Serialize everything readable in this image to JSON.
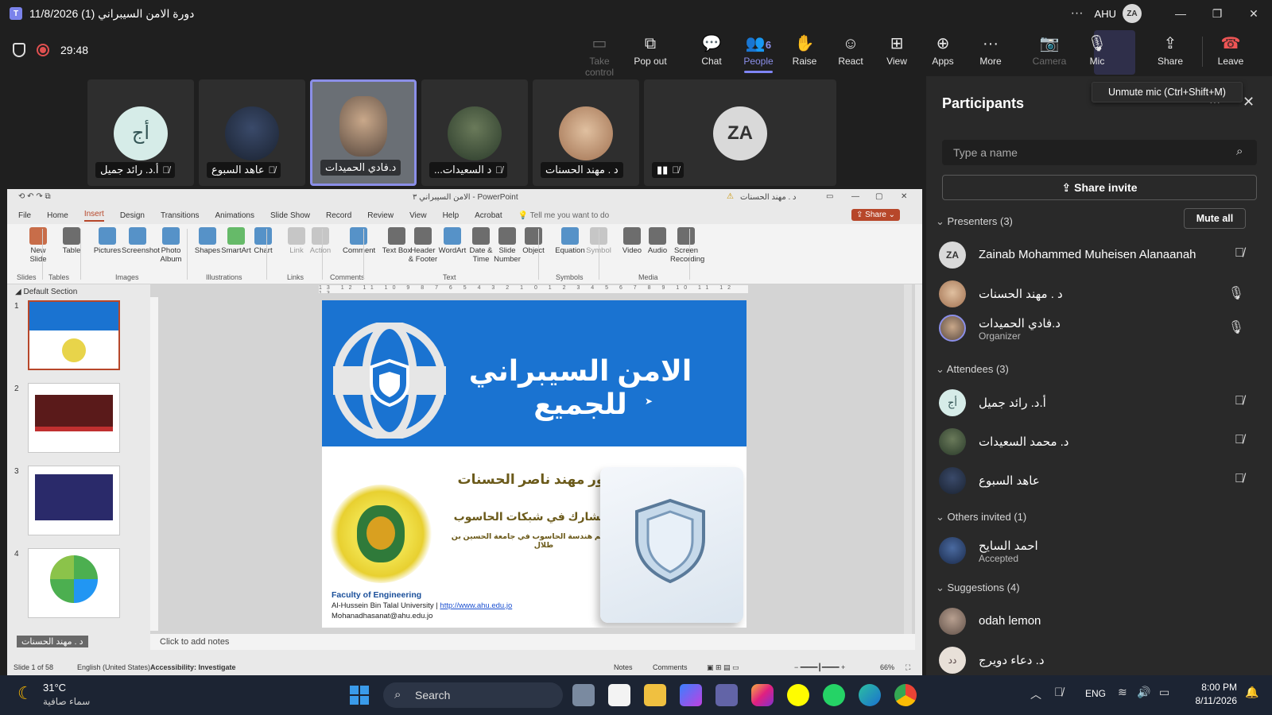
{
  "window": {
    "title": "دورة الامن السيبراني (1) 11/8/2026",
    "org": "AHU",
    "user_initials": "ZA"
  },
  "meeting": {
    "timer": "29:48",
    "buttons": [
      {
        "label": "Take control",
        "icon": "take-control-icon"
      },
      {
        "label": "Pop out",
        "icon": "pop-out-icon"
      },
      {
        "label": "Chat",
        "icon": "chat-icon"
      },
      {
        "label": "People",
        "icon": "people-icon",
        "count": "6"
      },
      {
        "label": "Raise",
        "icon": "raise-hand-icon"
      },
      {
        "label": "React",
        "icon": "react-icon"
      },
      {
        "label": "View",
        "icon": "view-icon"
      },
      {
        "label": "Apps",
        "icon": "apps-icon"
      },
      {
        "label": "More",
        "icon": "more-icon"
      },
      {
        "label": "Camera",
        "icon": "camera-off-icon"
      },
      {
        "label": "Mic",
        "icon": "mic-off-icon"
      },
      {
        "label": "Share",
        "icon": "share-icon"
      },
      {
        "label": "Leave",
        "icon": "leave-icon"
      }
    ],
    "tooltip": "Unmute mic (Ctrl+Shift+M)"
  },
  "tiles": [
    {
      "name": "أ.د. رائد جميل",
      "initials": "أج"
    },
    {
      "name": "عاهد السبوع"
    },
    {
      "name": "د.فادي الحميدات"
    },
    {
      "name": "د. محمد السعيدات",
      "display": "...د السعيدات"
    },
    {
      "name": "د . مهند الحسنات"
    },
    {
      "name": "",
      "initials": "ZA"
    }
  ],
  "ppt": {
    "title": "الامن السيبراني ٣ - PowerPoint",
    "user": "د . مهند الحسنات",
    "menu": [
      "File",
      "Home",
      "Insert",
      "Design",
      "Transitions",
      "Animations",
      "Slide Show",
      "Record",
      "Review",
      "View",
      "Help",
      "Acrobat"
    ],
    "tell_me": "Tell me you want to do",
    "share": "Share",
    "ribbon": [
      {
        "label": "New Slide"
      },
      {
        "label": "Table"
      },
      {
        "label": "Pictures"
      },
      {
        "label": "Screenshot"
      },
      {
        "label": "Photo Album"
      },
      {
        "label": "Shapes"
      },
      {
        "label": "SmartArt"
      },
      {
        "label": "Chart"
      },
      {
        "label": "Link"
      },
      {
        "label": "Action"
      },
      {
        "label": "Comment"
      },
      {
        "label": "Text Box"
      },
      {
        "label": "Header & Footer"
      },
      {
        "label": "WordArt"
      },
      {
        "label": "Date & Time"
      },
      {
        "label": "Slide Number"
      },
      {
        "label": "Object"
      },
      {
        "label": "Equation"
      },
      {
        "label": "Symbol"
      },
      {
        "label": "Video"
      },
      {
        "label": "Audio"
      },
      {
        "label": "Screen Recording"
      }
    ],
    "groups": [
      "Slides",
      "Tables",
      "Images",
      "Illustrations",
      "Links",
      "Comments",
      "Text",
      "Symbols",
      "Media"
    ],
    "section": "Default Section",
    "notes": "Click to add notes",
    "status": {
      "slide": "Slide 1 of 58",
      "lang": "English (United States)",
      "access": "Accessibility: Investigate",
      "notes": "Notes",
      "comments": "Comments",
      "zoom": "66%"
    },
    "presenter_label": "د . مهند الحسنات"
  },
  "slide": {
    "title": "الامن السيبراني للجميع",
    "presenter": "الدكتور مهند ناصر الحسنات",
    "role": "أستاذ مشارك في شبكات الحاسوب",
    "dept": "رئيس قسم هندسة الحاسوب في جامعة الحسين بن طلال",
    "faculty": "Faculty of Engineering",
    "university": "Al-Hussein Bin Talal University |",
    "url": "http://www.ahu.edu.jo",
    "email": "Mohanadhasanat@ahu.edu.jo"
  },
  "participants": {
    "header": "Participants",
    "search_placeholder": "Type a name",
    "share_invite": "Share invite",
    "mute_all": "Mute all",
    "presenters_label": "Presenters (3)",
    "presenters": [
      {
        "name": "Zainab Mohammed Muheisen Alanaanah",
        "initials": "ZA",
        "mic": "muted"
      },
      {
        "name": "د . مهند الحسنات",
        "mic": "on"
      },
      {
        "name": "د.فادي الحميدات",
        "sub": "Organizer",
        "mic": "on"
      }
    ],
    "attendees_label": "Attendees (3)",
    "attendees": [
      {
        "name": "أ.د. رائد جميل",
        "initials": "أج",
        "mic": "muted"
      },
      {
        "name": "د. محمد السعيدات",
        "mic": "muted"
      },
      {
        "name": "عاهد السبوع",
        "mic": "muted"
      }
    ],
    "others_label": "Others invited (1)",
    "others": [
      {
        "name": "احمد السايح",
        "sub": "Accepted"
      }
    ],
    "suggestions_label": "Suggestions (4)",
    "suggestions": [
      {
        "name": "odah lemon"
      },
      {
        "name": "د. دعاء دويرج",
        "initials": "دد"
      }
    ]
  },
  "taskbar": {
    "weather_temp": "31°C",
    "weather_desc": "سماء صافية",
    "search": "Search",
    "lang": "ENG",
    "time": "8:00 PM",
    "date": "8/11/2026"
  }
}
